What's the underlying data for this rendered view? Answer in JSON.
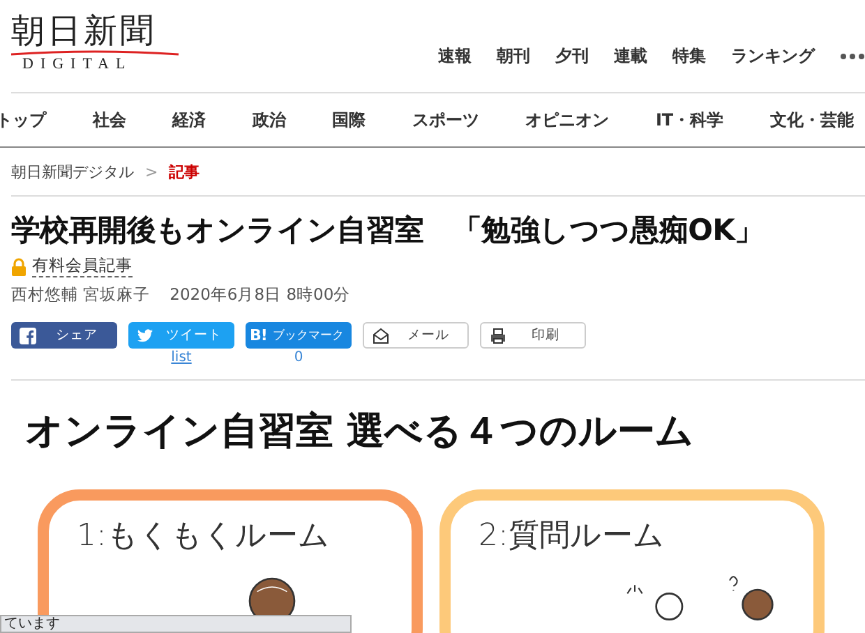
{
  "logo": {
    "title": "朝日新聞",
    "subtitle": "DIGITAL"
  },
  "top_nav": [
    "速報",
    "朝刊",
    "夕刊",
    "連載",
    "特集",
    "ランキング"
  ],
  "category_nav": [
    "トップ",
    "社会",
    "経済",
    "政治",
    "国際",
    "スポーツ",
    "オピニオン",
    "IT・科学",
    "文化・芸能"
  ],
  "breadcrumb": [
    {
      "label": "朝日新聞デジタル",
      "current": false
    },
    {
      "label": "記事",
      "current": true
    }
  ],
  "breadcrumb_separator": ">",
  "article": {
    "title": "学校再開後もオンライン自習室　「勉強しつつ愚痴OK」",
    "badge": "有料会員記事",
    "authors": "西村悠輔 宮坂麻子",
    "date": "2020年6月8日 8時00分"
  },
  "share_buttons": [
    {
      "kind": "facebook",
      "label": "シェア"
    },
    {
      "kind": "twitter",
      "label": "ツイート",
      "count": "list"
    },
    {
      "kind": "hatena",
      "label": "ブックマーク",
      "icon_text": "B!",
      "count": "0"
    },
    {
      "kind": "mail",
      "label": "メール"
    },
    {
      "kind": "print",
      "label": "印刷"
    }
  ],
  "infographic": {
    "title": "オンライン自習室 選べる４つのルーム",
    "rooms": [
      {
        "label": "1:もくもくルーム",
        "color": "#f99a5e"
      },
      {
        "label": "2:質問ルーム",
        "color": "#fdc97a"
      }
    ]
  },
  "status_bar": {
    "text": "ています"
  }
}
